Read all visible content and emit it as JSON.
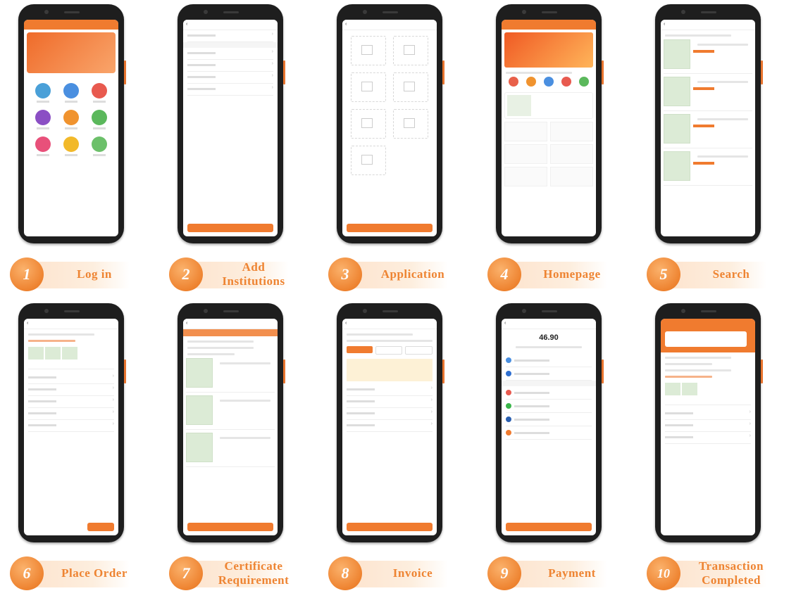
{
  "steps": [
    {
      "number": "1",
      "label": "Log in"
    },
    {
      "number": "2",
      "label": "Add Institutions"
    },
    {
      "number": "3",
      "label": "Application"
    },
    {
      "number": "4",
      "label": "Homepage"
    },
    {
      "number": "5",
      "label": "Search"
    },
    {
      "number": "6",
      "label": "Place Order"
    },
    {
      "number": "7",
      "label": "Certificate Requirement"
    },
    {
      "number": "8",
      "label": "Invoice"
    },
    {
      "number": "9",
      "label": "Payment"
    },
    {
      "number": "10",
      "label": "Transaction Completed"
    }
  ],
  "screens": {
    "payment_amount": "46.90"
  },
  "colors": {
    "accent": "#f07b2f",
    "label_text": "#ee8432",
    "label_band": "#fde3cd",
    "phone_body": "#1e1e1e"
  }
}
